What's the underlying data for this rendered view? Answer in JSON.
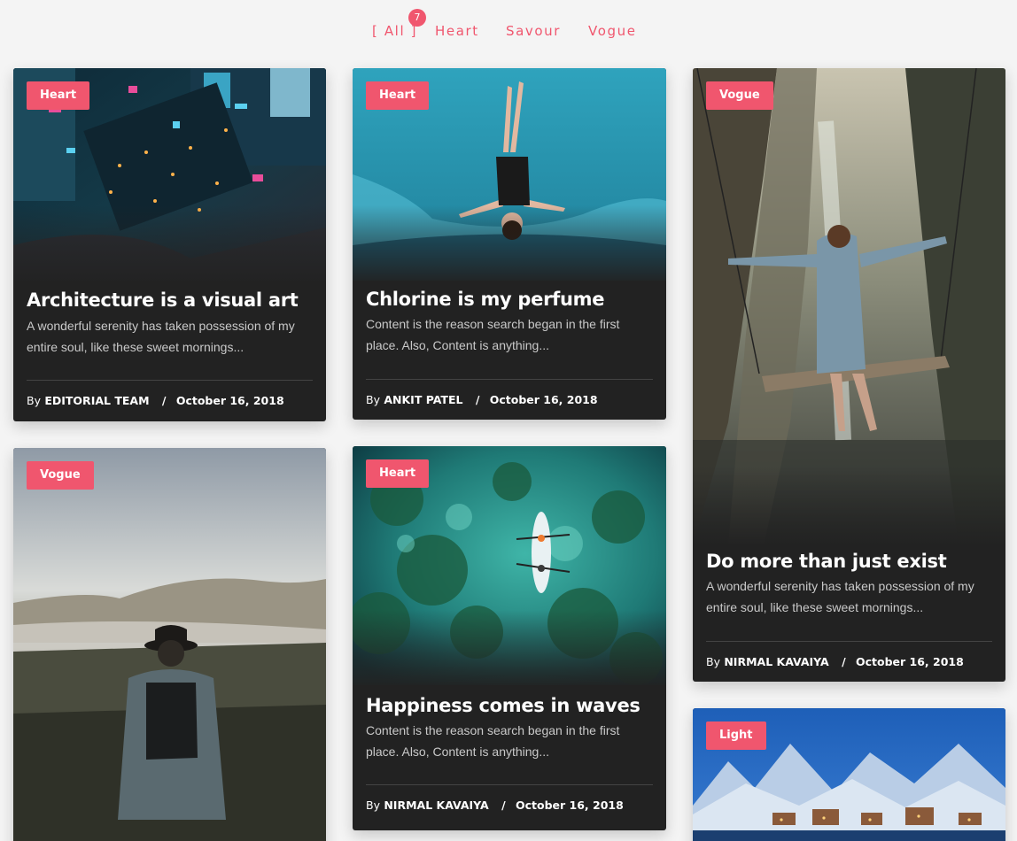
{
  "filters": {
    "all_label": "[ All ]",
    "all_count": "7",
    "heart_label": "Heart",
    "savour_label": "Savour",
    "vogue_label": "Vogue"
  },
  "cards": [
    {
      "tag": "Heart",
      "title": "Architecture is a visual art",
      "excerpt": "A wonderful serenity has taken possession of my entire soul, like these sweet mornings...",
      "by": "By",
      "author": "Editorial Team",
      "sep": "/",
      "date": "October 16, 2018"
    },
    {
      "tag": "Heart",
      "title": "Chlorine is my perfume",
      "excerpt": "Content is the reason search began in the first place. Also, Content is anything...",
      "by": "By",
      "author": "Ankit Patel",
      "sep": "/",
      "date": "October 16, 2018"
    },
    {
      "tag": "Vogue",
      "title": "Do more than just exist",
      "excerpt": "A wonderful serenity has taken possession of my entire soul, like these sweet mornings...",
      "by": "By",
      "author": "Nirmal Kavaiya",
      "sep": "/",
      "date": "October 16, 2018"
    },
    {
      "tag": "Vogue"
    },
    {
      "tag": "Heart",
      "title": "Happiness comes in waves",
      "excerpt": "Content is the reason search began in the first place. Also, Content is anything...",
      "by": "By",
      "author": "Nirmal Kavaiya",
      "sep": "/",
      "date": "October 16, 2018"
    },
    {
      "tag": "Light"
    }
  ],
  "colors": {
    "accent": "#f0566e",
    "card_bg": "#222222",
    "page_bg": "#f4f4f4"
  }
}
